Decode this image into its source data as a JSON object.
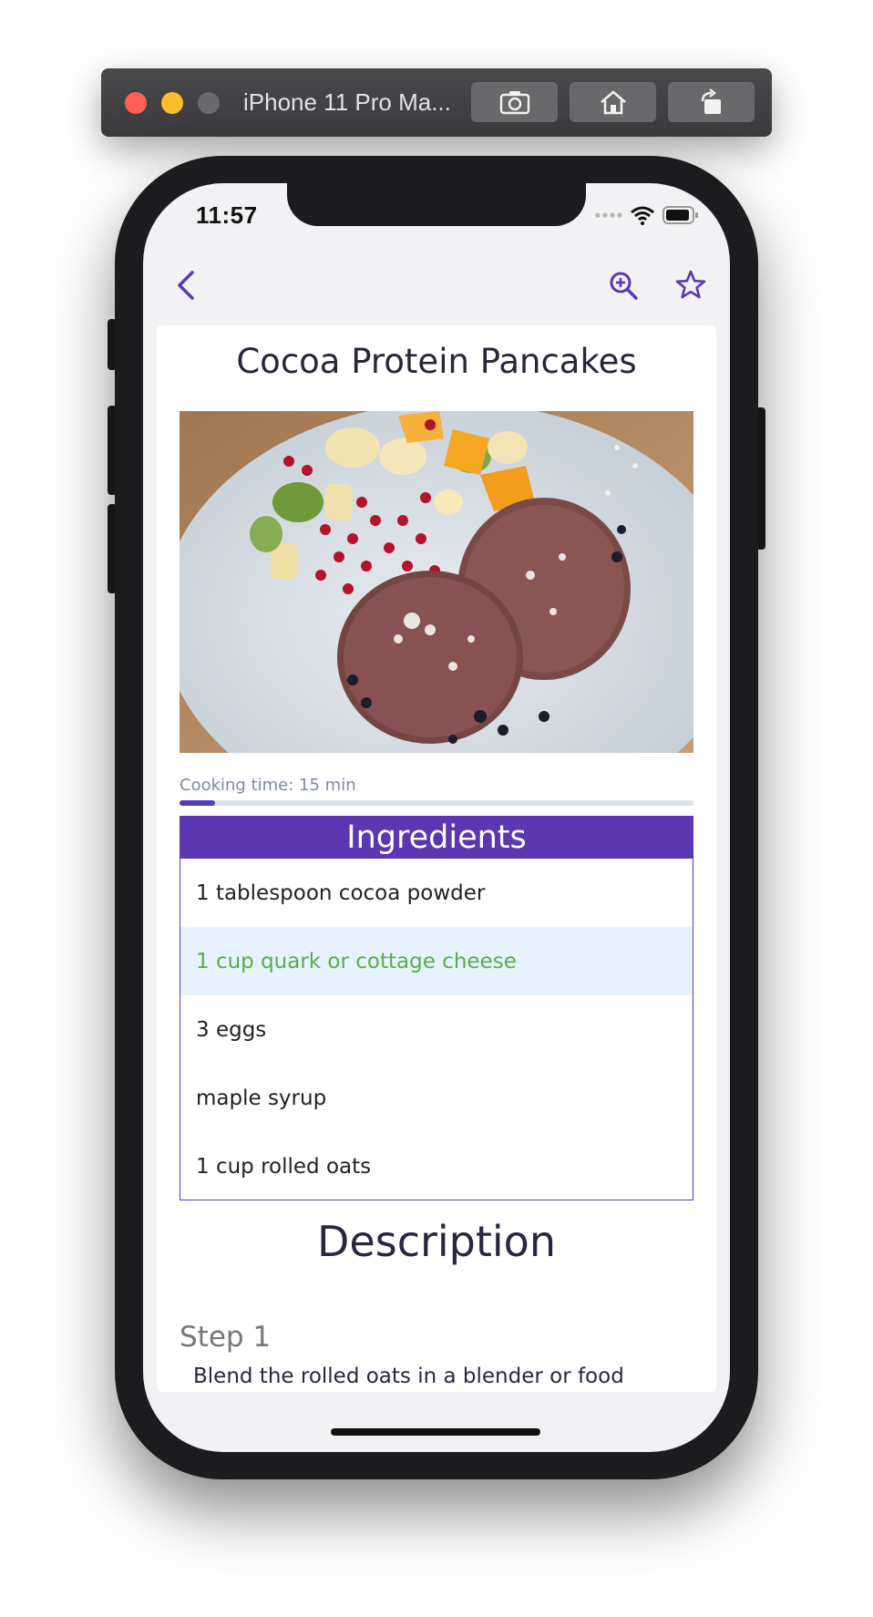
{
  "simulator": {
    "title": "iPhone 11 Pro Ma..."
  },
  "status_bar": {
    "time": "11:57"
  },
  "recipe": {
    "title": "Cocoa Protein Pancakes",
    "cooking_time_label": "Cooking time: 15 min",
    "cooking_progress_fraction": 0.07
  },
  "ingredients": {
    "header": "Ingredients",
    "items": [
      {
        "text": "1 tablespoon cocoa powder",
        "highlighted": false
      },
      {
        "text": "1 cup quark or cottage cheese",
        "highlighted": true
      },
      {
        "text": "3 eggs",
        "highlighted": false
      },
      {
        "text": "maple syrup",
        "highlighted": false
      },
      {
        "text": "1 cup rolled oats",
        "highlighted": false
      }
    ]
  },
  "description": {
    "title": "Description",
    "steps": [
      {
        "title": "Step 1",
        "text": "Blend the rolled oats in a blender or food"
      }
    ]
  },
  "colors": {
    "accent": "#5b37b1",
    "highlight_bg": "#e6f3fd",
    "highlight_text": "#58ad4a"
  },
  "icons": {
    "back": "chevron-left-icon",
    "zoom": "zoom-in-icon",
    "favorite": "star-icon"
  }
}
